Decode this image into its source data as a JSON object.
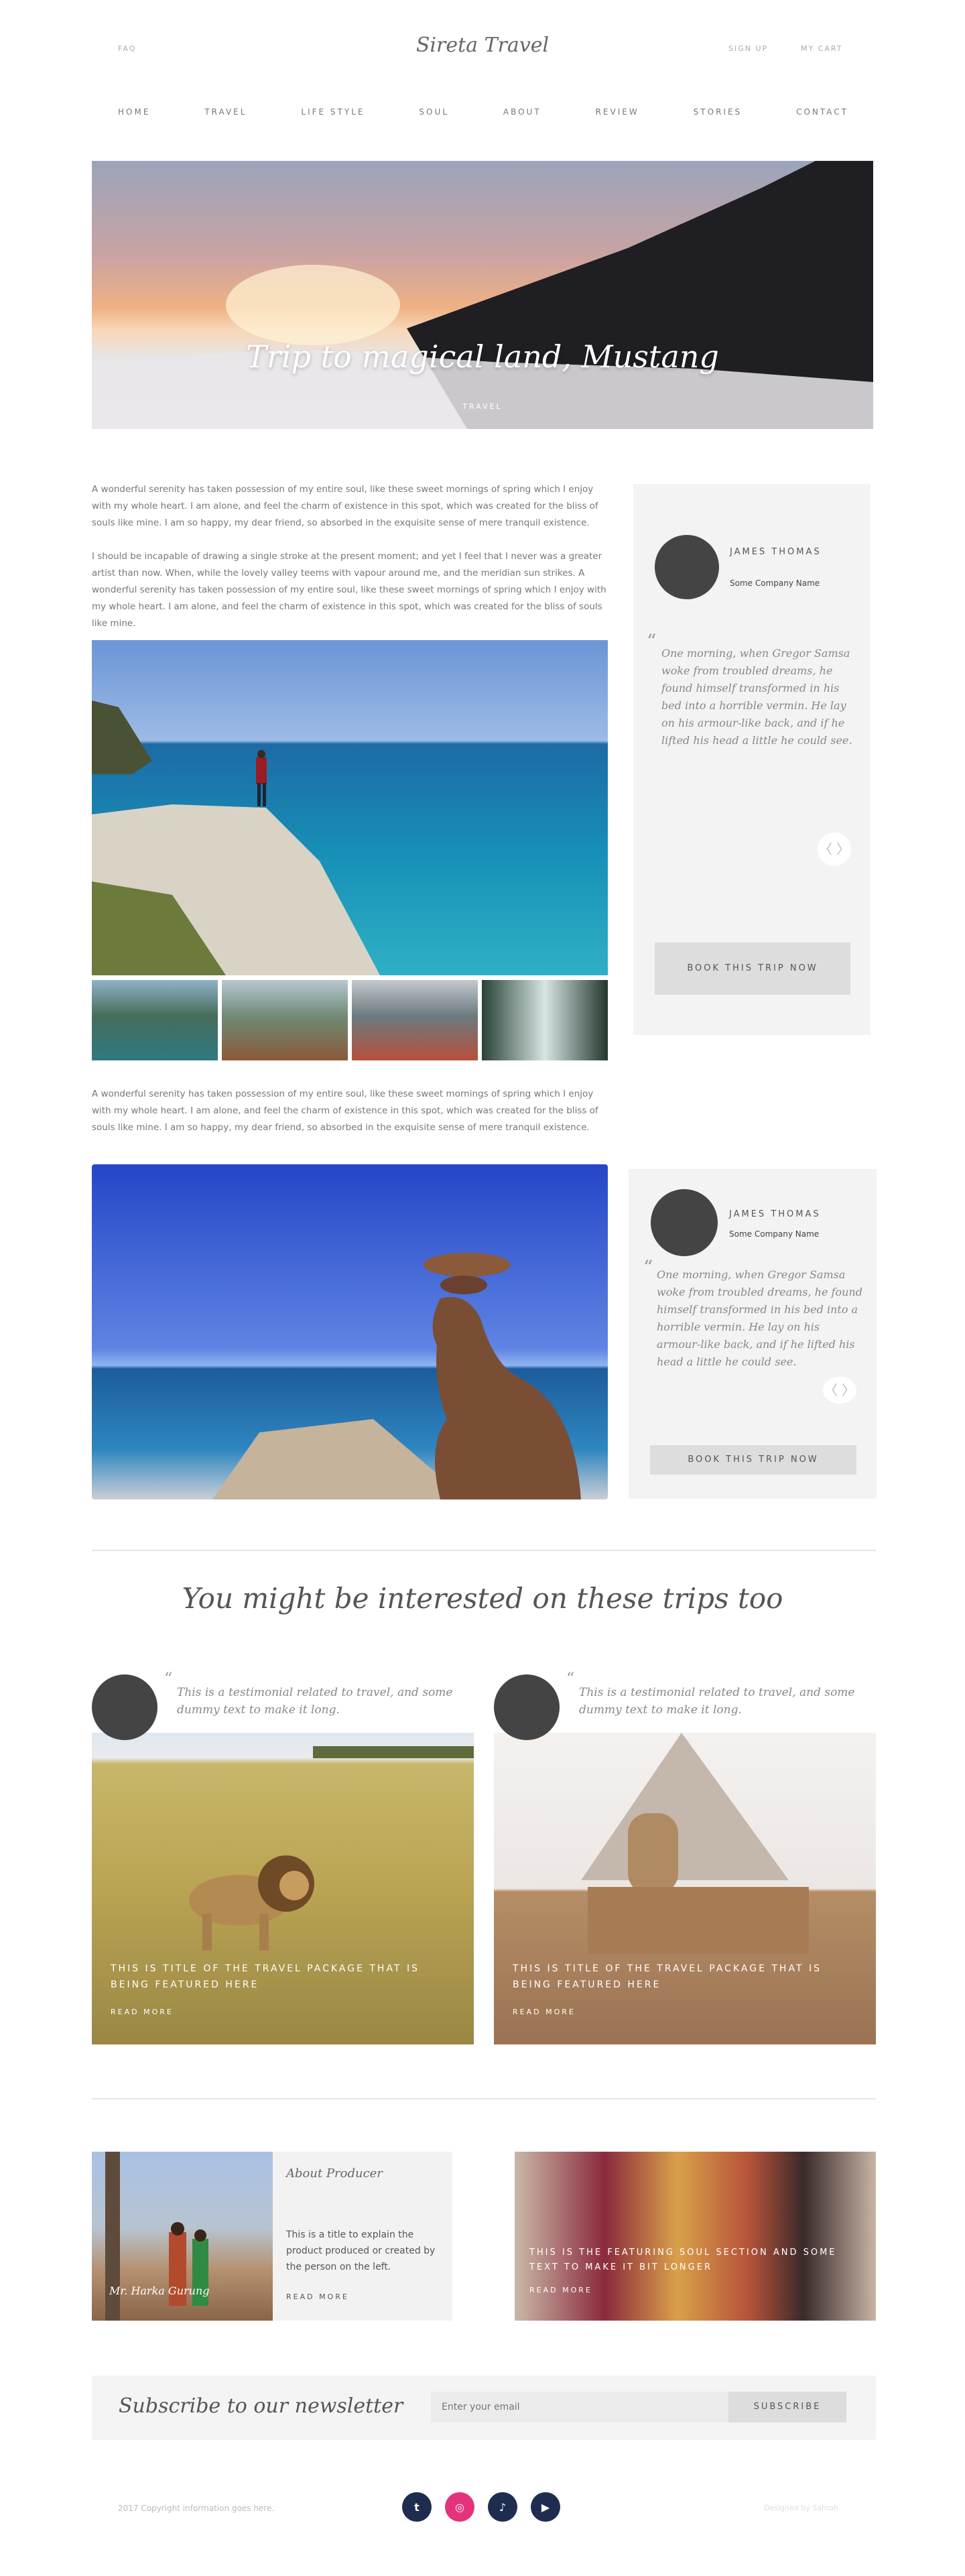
{
  "header": {
    "faq": "FAQ",
    "logo": "Sireta Travel",
    "signup": "SIGN UP",
    "cart": "MY CART"
  },
  "nav": [
    "HOME",
    "TRAVEL",
    "LIFE STYLE",
    "SOUL",
    "ABOUT",
    "REVIEW",
    "STORIES",
    "CONTACT"
  ],
  "hero": {
    "title": "Trip to magical land, Mustang",
    "category": "TRAVEL"
  },
  "article": {
    "p1": "A wonderful serenity has taken possession of my entire soul, like these sweet mornings of spring which I enjoy with my whole heart. I am alone, and feel the charm of existence in this spot, which was created for the bliss of souls like mine. I am so happy, my dear friend, so absorbed in the exquisite sense of mere tranquil existence.",
    "p2": "I should be incapable of drawing a single stroke at the present moment; and yet I feel that I never was a greater artist than now. When, while the lovely valley teems with vapour around me, and the meridian sun strikes. A wonderful serenity has taken possession of my entire soul, like these sweet mornings of spring which I enjoy with my whole heart. I am alone, and feel the charm of existence in this spot, which was created for the bliss of souls like mine.",
    "p3": "A wonderful serenity has taken possession of my entire soul, like these sweet mornings of spring which I enjoy with my whole heart. I am alone, and feel the charm of existence in this spot, which was created for the bliss of souls like mine. I am so happy, my dear friend, so absorbed in the exquisite sense of mere tranquil existence."
  },
  "sidebar1": {
    "name": "JAMES THOMAS",
    "company": "Some Company Name",
    "quote": "One morning, when Gregor Samsa woke from troubled dreams, he found himself transformed in his bed into a horrible vermin. He lay on his armour-like back, and if he lifted his head a little he could see.",
    "book": "BOOK THIS TRIP NOW",
    "arrows": "〈 〉"
  },
  "sidebar2": {
    "name": "JAMES THOMAS",
    "company": "Some Company Name",
    "quote": "One morning, when Gregor Samsa woke from troubled dreams, he found himself transformed in his bed into a horrible vermin. He lay on his armour-like back, and if he lifted his head a little he could see.",
    "book": "BOOK THIS TRIP NOW",
    "arrows": "〈 〉"
  },
  "related": {
    "heading": "You might be interested on these trips too",
    "cards": [
      {
        "testimonial": "This is a testimonial related to travel, and some dummy text to make it long.",
        "title": "THIS IS TITLE OF THE TRAVEL PACKAGE THAT IS BEING FEATURED HERE",
        "read_more": "READ MORE"
      },
      {
        "testimonial": "This is a testimonial related to travel, and some dummy text to make it long.",
        "title": "THIS IS TITLE OF THE TRAVEL PACKAGE THAT IS BEING FEATURED HERE",
        "read_more": "READ MORE"
      }
    ]
  },
  "producer": {
    "caption": "Mr. Harka Gurung",
    "heading": "About Producer",
    "text": "This is a title to explain the product produced or created by the person on the left.",
    "read_more": "READ MORE"
  },
  "soul": {
    "title": "THIS IS THE FEATURING SOUL SECTION AND SOME TEXT TO MAKE IT BIT LONGER",
    "read_more": "READ MORE"
  },
  "newsletter": {
    "heading": "Subscribe to our newsletter",
    "placeholder": "Enter your email",
    "button": "SUBSCRIBE"
  },
  "footer": {
    "copyright": "2017 Copyright information goes here.",
    "designed": "Designed by Sahroh",
    "social": [
      {
        "icon": "twitter-icon",
        "glyph": "t",
        "color": "#1e2d4f"
      },
      {
        "icon": "instagram-icon",
        "glyph": "◎",
        "color": "#e5337b"
      },
      {
        "icon": "tiktok-icon",
        "glyph": "♪",
        "color": "#1e2d4f"
      },
      {
        "icon": "youtube-icon",
        "glyph": "▶",
        "color": "#1e2d4f"
      }
    ]
  }
}
